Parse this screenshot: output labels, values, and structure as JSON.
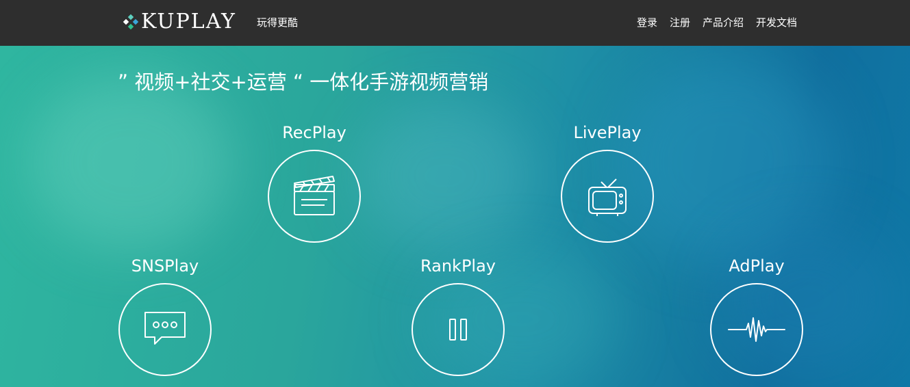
{
  "brand": {
    "logo_text": "KUPLAY",
    "tagline": "玩得更酷",
    "logo_mark_colors": [
      "#5ecfbf",
      "#3aa6d8",
      "#2fbf8f",
      "#ffffff"
    ]
  },
  "nav": {
    "items": [
      {
        "label": "登录"
      },
      {
        "label": "注册"
      },
      {
        "label": "产品介绍"
      },
      {
        "label": "开发文档"
      }
    ]
  },
  "hero": {
    "title": "” 视频+社交+运营 “ 一体化手游视频营销",
    "colors": {
      "navbar_bg": "#2e2e2e",
      "teal": "#2fb6a0",
      "blue": "#106f9e",
      "icon_stroke": "#ffffff"
    }
  },
  "products": [
    {
      "label": "RecPlay",
      "icon": "clapperboard-icon"
    },
    {
      "label": "LivePlay",
      "icon": "tv-icon"
    },
    {
      "label": "SNSPlay",
      "icon": "chat-bubble-icon"
    },
    {
      "label": "RankPlay",
      "icon": "pause-icon"
    },
    {
      "label": "AdPlay",
      "icon": "sound-wave-icon"
    }
  ]
}
